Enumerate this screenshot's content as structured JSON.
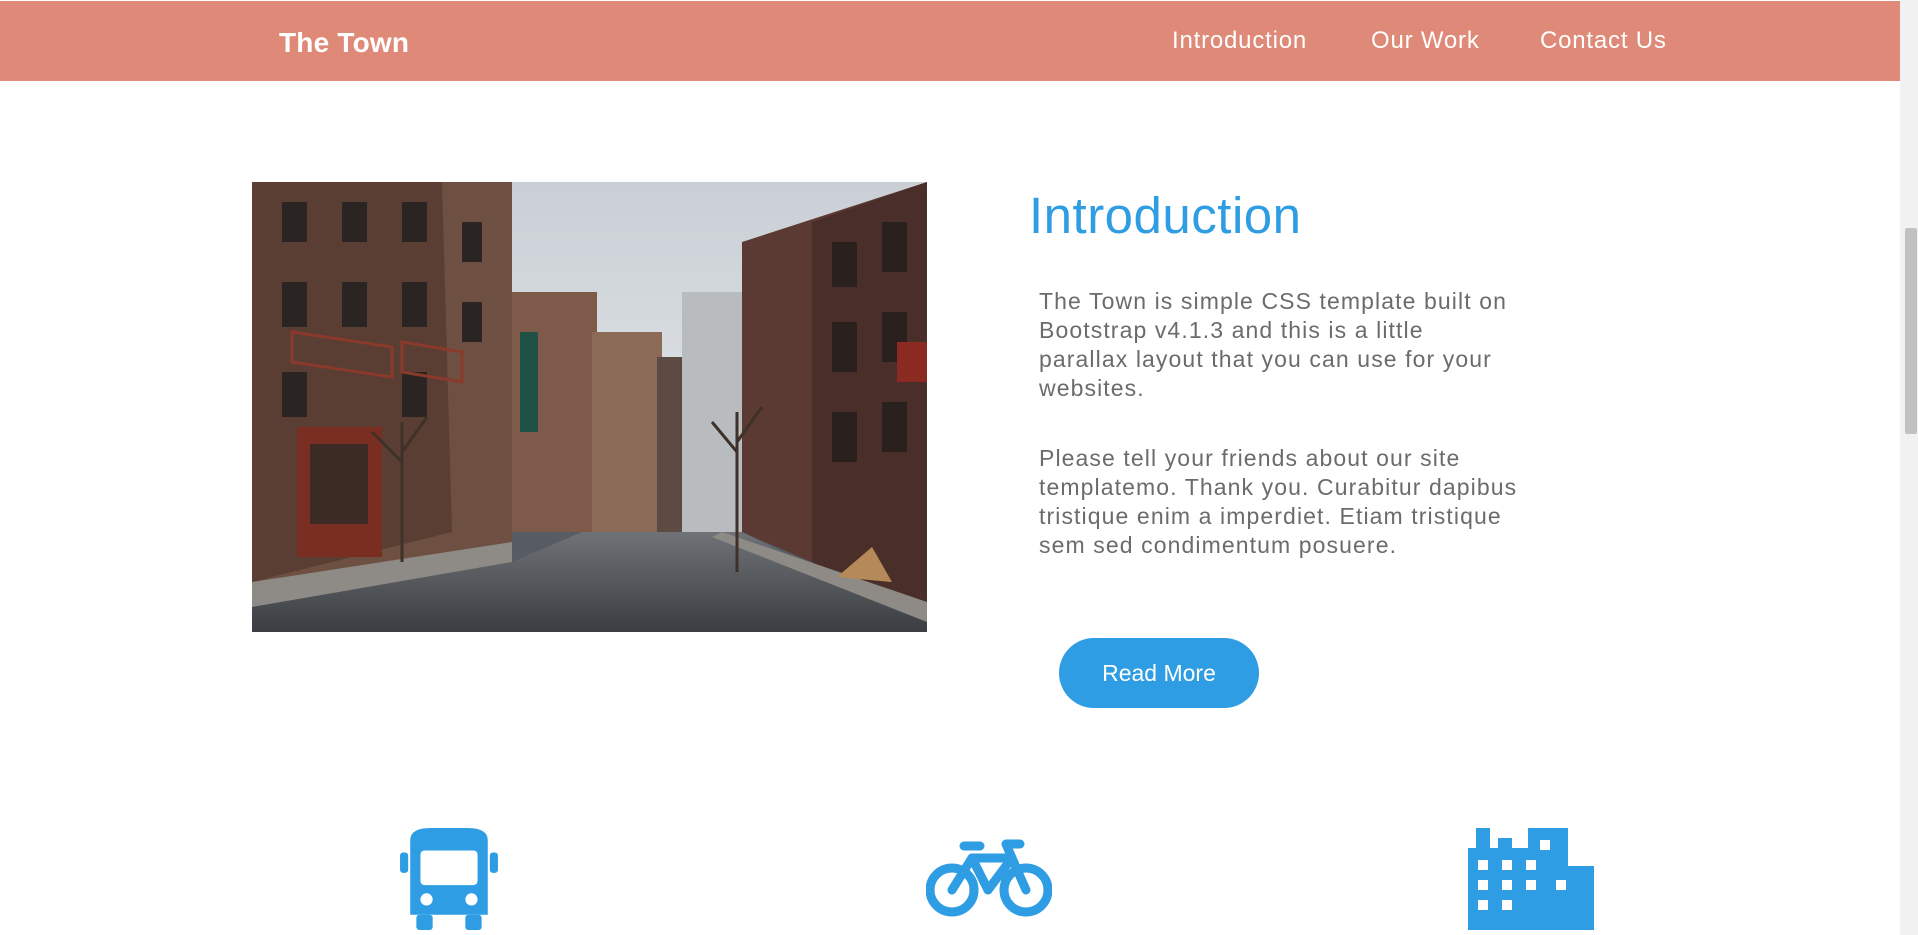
{
  "navbar": {
    "brand": "The Town",
    "links": [
      "Introduction",
      "Our Work",
      "Contact Us"
    ]
  },
  "intro": {
    "title": "Introduction",
    "paragraphs": [
      "The Town is simple CSS template built on Bootstrap v4.1.3 and this is a little parallax layout that you can use for your websites.",
      "Please tell your friends about our site templatemo. Thank you. Curabitur dapibus tristique enim a imperdiet. Etiam tristique sem sed condimentum posuere."
    ],
    "button_label": "Read More"
  },
  "features": {
    "icons": [
      "bus-icon",
      "bicycle-icon",
      "building-icon"
    ]
  },
  "colors": {
    "navbar": "#df8a78",
    "accent": "#2e9de3",
    "body_text": "#6b6b6b"
  }
}
